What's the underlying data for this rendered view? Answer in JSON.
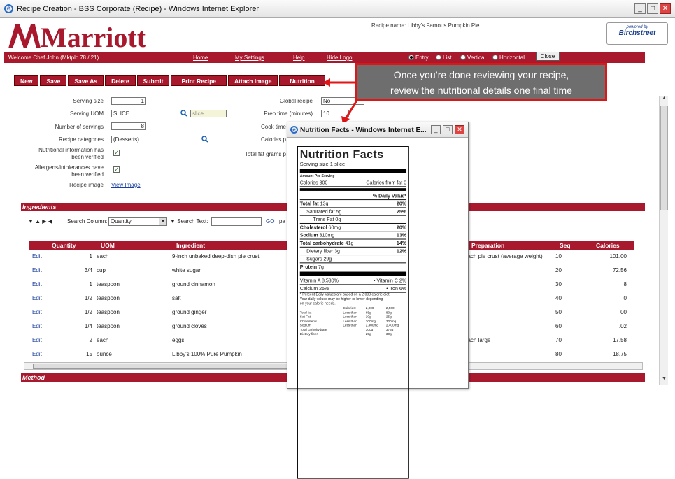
{
  "window": {
    "title": "Recipe Creation - BSS Corporate (Recipe) - Windows Internet Explorer",
    "min": "_",
    "max": "□",
    "close": "✕"
  },
  "header": {
    "logo_text": "Marriott",
    "recipe_name": "Recipe name: Libby's Famous Pumpkin Pie",
    "powered_by": "powered by",
    "powered_brand": "Birchstreet"
  },
  "redbar": {
    "welcome": "Welcome Chef John (Mktplc 78 / 21)",
    "nav": [
      "Home",
      "My Settings",
      "Help",
      "Hide Logo"
    ],
    "view_modes": [
      "Entry",
      "List",
      "Vertical",
      "Horizontal"
    ],
    "selected_mode": "Entry",
    "close_label": "Close"
  },
  "toolbar": [
    "New",
    "Save",
    "Save As",
    "Delete",
    "Submit",
    "Print Recipe",
    "Attach Image",
    "Nutrition"
  ],
  "form": {
    "serving_size_label": "Serving size",
    "serving_size_value": "1",
    "serving_uom_label": "Serving UOM",
    "serving_uom_value": "SLICE",
    "serving_uom_lookup": "slice",
    "num_servings_label": "Number of servings",
    "num_servings_value": "8",
    "categories_label": "Recipe categories",
    "categories_value": "(Desserts)",
    "nutrition_verified_label": "Nutritional information has been verified",
    "allergens_verified_label": "Allergens/intolerances have been verified",
    "recipe_image_label": "Recipe image",
    "view_image": "View Image",
    "global_recipe_label": "Global recipe",
    "global_recipe_value": "No",
    "prep_time_label": "Prep time (minutes)",
    "prep_time_value": "10",
    "cook_time_label": "Cook time",
    "calories_label": "Calories p",
    "total_fat_label": "Total fat grams p"
  },
  "ingredients": {
    "section_title": "Ingredients",
    "search_column_label": "Search Column:",
    "search_column_value": "Quantity",
    "search_text_label": "Search Text:",
    "go_label": "GO",
    "page_label": "pa",
    "columns": [
      "Quantity",
      "UOM",
      "Ingredient",
      "Preparation",
      "Seq",
      "Calories"
    ],
    "rows": [
      {
        "edit": "Edit",
        "qty": "1",
        "uom": "each",
        "ingredient": "9-inch unbaked deep-dish pie crust",
        "prep": "each pie crust (average weight)",
        "seq": "10",
        "cal": "101.00"
      },
      {
        "edit": "Edit",
        "qty": "3/4",
        "uom": "cup",
        "ingredient": "white sugar",
        "prep": "",
        "seq": "20",
        "cal": "72.56"
      },
      {
        "edit": "Edit",
        "qty": "1",
        "uom": "teaspoon",
        "ingredient": "ground cinnamon",
        "prep": "",
        "seq": "30",
        "cal": ".8"
      },
      {
        "edit": "Edit",
        "qty": "1/2",
        "uom": "teaspoon",
        "ingredient": "salt",
        "prep": "",
        "seq": "40",
        "cal": "0"
      },
      {
        "edit": "Edit",
        "qty": "1/2",
        "uom": "teaspoon",
        "ingredient": "ground ginger",
        "prep": "",
        "seq": "50",
        "cal": "00"
      },
      {
        "edit": "Edit",
        "qty": "1/4",
        "uom": "teaspoon",
        "ingredient": "ground cloves",
        "prep": "",
        "seq": "60",
        "cal": ".02"
      },
      {
        "edit": "Edit",
        "qty": "2",
        "uom": "each",
        "ingredient": "eggs",
        "prep": "each large",
        "seq": "70",
        "cal": "17.58"
      },
      {
        "edit": "Edit",
        "qty": "15",
        "uom": "ounce",
        "ingredient": "Libby's 100% Pure Pumpkin",
        "prep": "",
        "seq": "80",
        "cal": "18.75"
      }
    ]
  },
  "method": {
    "section_title": "Method"
  },
  "callout": {
    "line1": "Once you’re done reviewing your recipe,",
    "line2": "review the nutritional details one final time"
  },
  "popup": {
    "title": "Nutrition Facts - Windows Internet E...",
    "nf_title": "Nutrition Facts",
    "serving_size": "Serving size 1 slice",
    "amount_per": "Amount Per Serving",
    "calories": "Calories 300",
    "calories_fat": "Calories from fat 0",
    "daily_value": "% Daily Value*",
    "total_fat": "Total fat",
    "total_fat_val": "13g",
    "total_fat_pct": "20%",
    "sat_fat": "Saturated fat 5g",
    "sat_fat_pct": "25%",
    "trans_fat": "Trans Fat 0g",
    "cholesterol": "Cholesterol",
    "chol_val": "60mg",
    "chol_pct": "20%",
    "sodium": "Sodium",
    "sodium_val": "310mg",
    "sodium_pct": "13%",
    "carb": "Total carbohydrate",
    "carb_val": "41g",
    "carb_pct": "14%",
    "fiber": "Dietary fiber 3g",
    "fiber_pct": "12%",
    "sugars": "Sugars 29g",
    "protein": "Protein",
    "protein_val": "7g",
    "vit_a": "Vitamin A 8,530%",
    "vit_c": "Vitamin C 2%",
    "calcium": "Calcium 25%",
    "iron": "Iron 6%",
    "footnote1": "* Percent Daily Values are based on a 2,000 calorie diet.",
    "footnote2": "Your daily values may be higher or lower depending",
    "footnote3": "on your calorie needs.",
    "ref_header": [
      "Calories:",
      "2,000",
      "2,500"
    ],
    "ref_rows": [
      [
        "Total fat",
        "Less than",
        "65g",
        "80g"
      ],
      [
        "Sat Fat",
        "Less than",
        "20g",
        "25g"
      ],
      [
        "Cholesterol",
        "Less than",
        "300mg",
        "300mg"
      ],
      [
        "Sodium",
        "Less than",
        "2,400mg",
        "2,400mg"
      ],
      [
        "Total carbohydrate",
        "",
        "300g",
        "375g"
      ],
      [
        "Dietary fiber",
        "",
        "25g",
        "30g"
      ]
    ]
  },
  "colors": {
    "brand_red": "#a8192e",
    "callout_border": "#e01616",
    "callout_bg": "#6e6e6e"
  }
}
